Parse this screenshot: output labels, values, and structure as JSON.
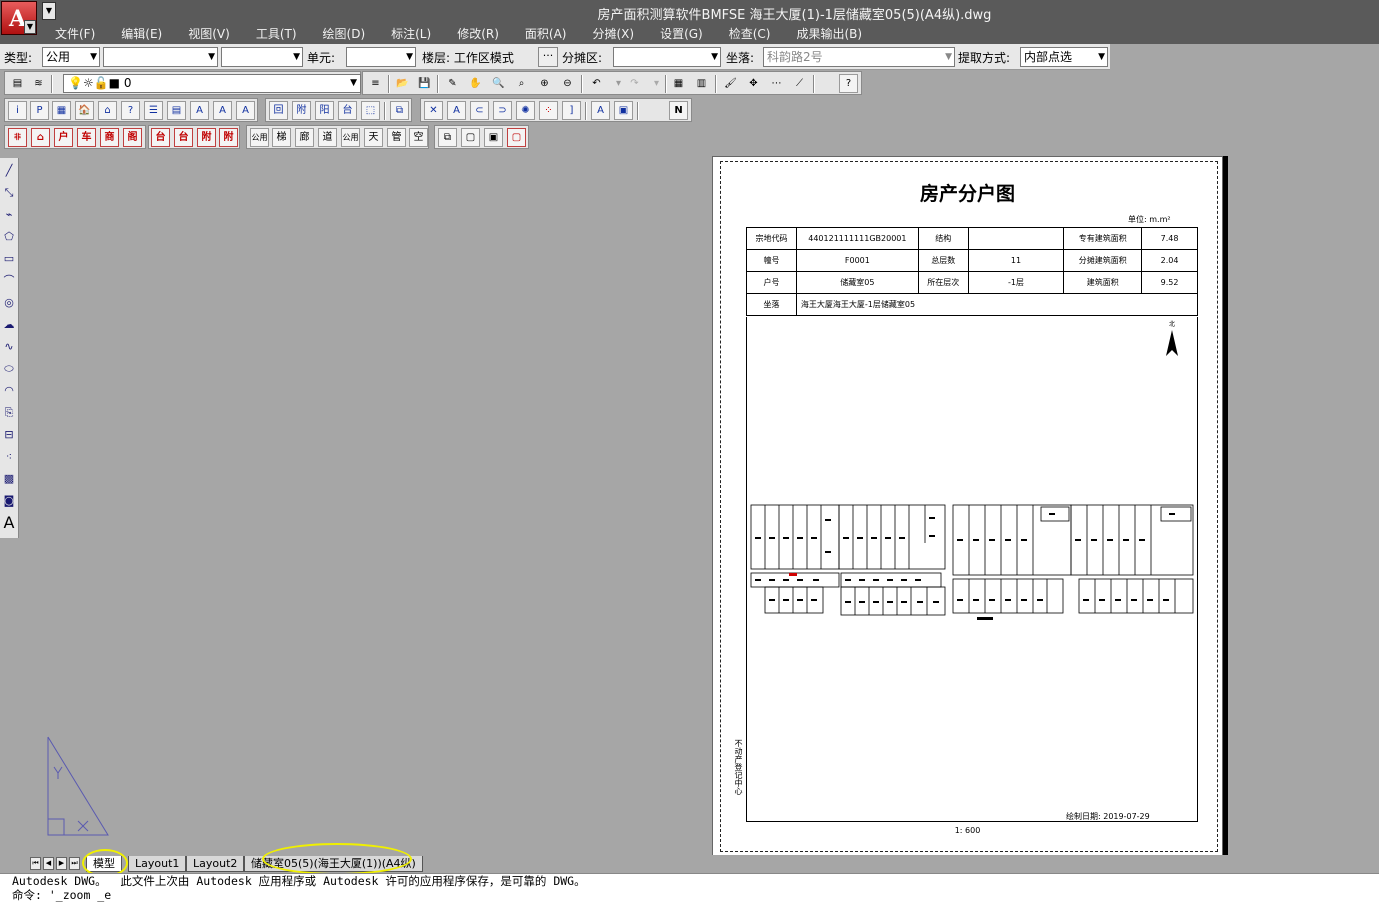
{
  "app": {
    "title": "房产面积测算软件BMFSE    海王大厦(1)-1层储藏室05(5)(A4纵).dwg",
    "logo_letter": "A"
  },
  "menu": [
    "文件(F)",
    "编辑(E)",
    "视图(V)",
    "工具(T)",
    "绘图(D)",
    "标注(L)",
    "修改(R)",
    "面积(A)",
    "分摊(X)",
    "设置(G)",
    "检查(C)",
    "成果输出(B)"
  ],
  "properties": {
    "type_label": "类型:",
    "type_value": "公用",
    "unit_label": "单元:",
    "floor_label": "楼层: 工作区模式",
    "dots": "···",
    "share_label": "分摊区:",
    "address_label": "坐落:",
    "address_value": "科韵路2号",
    "method_label": "提取方式:",
    "method_value": "内部点选"
  },
  "layer": {
    "current": "0"
  },
  "document": {
    "title": "房产分户图",
    "unit": "单位: m.m²",
    "rows": [
      [
        "宗地代码",
        "440121111111GB20001",
        "结构",
        "",
        "专有建筑面积",
        "7.48"
      ],
      [
        "幢号",
        "F0001",
        "总层数",
        "11",
        "分摊建筑面积",
        "2.04"
      ],
      [
        "户号",
        "储藏室05",
        "所在层次",
        "-1层",
        "建筑面积",
        "9.52"
      ]
    ],
    "address_label": "坐落",
    "address_value": "海王大厦海王大厦-1层储藏室05",
    "north": "北",
    "agency": "不动产登记中心",
    "draw_date": "绘制日期: 2019-07-29",
    "scale": "1: 600"
  },
  "tabs": {
    "model": "模型",
    "layout1": "Layout1",
    "layout2": "Layout2",
    "layout3": "储藏室05(5)(海王大厦(1))(A4纵)"
  },
  "command": {
    "line1": "Autodesk DWG。  此文件上次由 Autodesk 应用程序或 Autodesk 许可的应用程序保存，是可靠的 DWG。",
    "line2": "命令: '_zoom _e"
  },
  "colors": {
    "menu_bg": "#5a5a5a",
    "canvas": "#a6a6a6",
    "highlight": "#f0f000",
    "ucs": "#5a5ab0"
  },
  "draw_tools": [
    "line-icon",
    "construction-line-icon",
    "polyline-icon",
    "polygon-icon",
    "rectangle-icon",
    "arc-icon",
    "circle-icon",
    "revcloud-icon",
    "spline-icon",
    "ellipse-icon",
    "ellipse-arc-icon",
    "insert-block-icon",
    "make-block-icon",
    "point-icon",
    "hatch-icon",
    "region-icon",
    "mtext-icon"
  ]
}
